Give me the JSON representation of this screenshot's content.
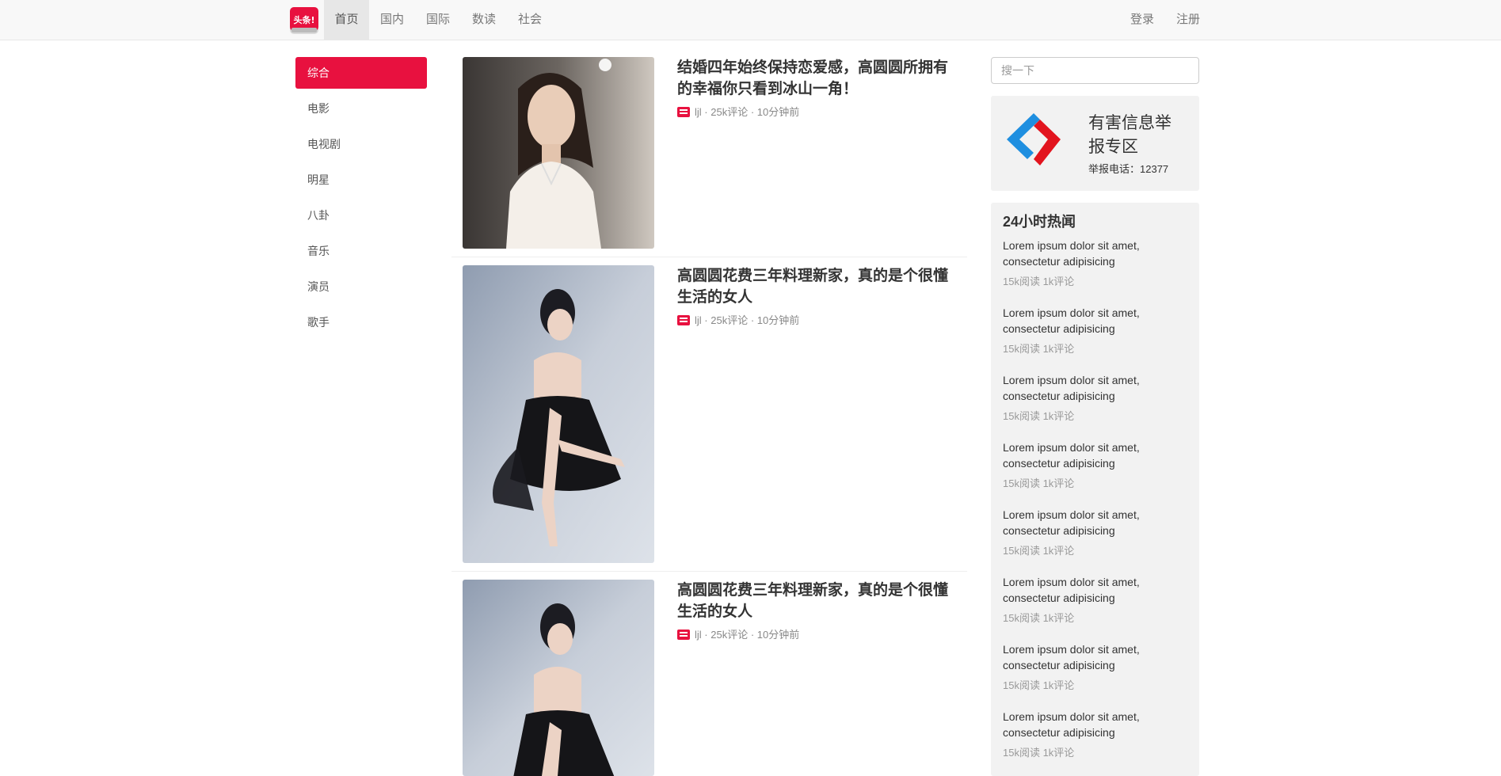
{
  "nav": {
    "logo_text": "头条!",
    "items": [
      "首页",
      "国内",
      "国际",
      "数读",
      "社会"
    ],
    "login": "登录",
    "register": "注册"
  },
  "sidebar": {
    "items": [
      "综合",
      "电影",
      "电视剧",
      "明星",
      "八卦",
      "音乐",
      "演员",
      "歌手"
    ],
    "active_index": 0
  },
  "articles": [
    {
      "title": "结婚四年始终保持恋爱感，高圆圆所拥有的幸福你只看到冰山一角！",
      "author": "ljl",
      "comments": "25k评论",
      "time": "10分钟前"
    },
    {
      "title": "高圆圆花费三年料理新家，真的是个很懂生活的女人",
      "author": "ljl",
      "comments": "25k评论",
      "time": "10分钟前"
    },
    {
      "title": "高圆圆花费三年料理新家，真的是个很懂生活的女人",
      "author": "ljl",
      "comments": "25k评论",
      "time": "10分钟前"
    }
  ],
  "search": {
    "placeholder": "搜一下"
  },
  "report": {
    "title": "有害信息举报专区",
    "phone": "举报电话：12377"
  },
  "hot": {
    "title": "24小时热闻",
    "items": [
      {
        "text": "Lorem ipsum dolor sit amet, consectetur adipisicing",
        "meta": "15k阅读 1k评论"
      },
      {
        "text": "Lorem ipsum dolor sit amet, consectetur adipisicing",
        "meta": "15k阅读 1k评论"
      },
      {
        "text": "Lorem ipsum dolor sit amet, consectetur adipisicing",
        "meta": "15k阅读 1k评论"
      },
      {
        "text": "Lorem ipsum dolor sit amet, consectetur adipisicing",
        "meta": "15k阅读 1k评论"
      },
      {
        "text": "Lorem ipsum dolor sit amet, consectetur adipisicing",
        "meta": "15k阅读 1k评论"
      },
      {
        "text": "Lorem ipsum dolor sit amet, consectetur adipisicing",
        "meta": "15k阅读 1k评论"
      },
      {
        "text": "Lorem ipsum dolor sit amet, consectetur adipisicing",
        "meta": "15k阅读 1k评论"
      },
      {
        "text": "Lorem ipsum dolor sit amet, consectetur adipisicing",
        "meta": "15k阅读 1k评论"
      }
    ]
  },
  "colors": {
    "accent": "#e8113f",
    "nav_bg": "#f8f8f8",
    "panel_bg": "#f2f2f2"
  }
}
